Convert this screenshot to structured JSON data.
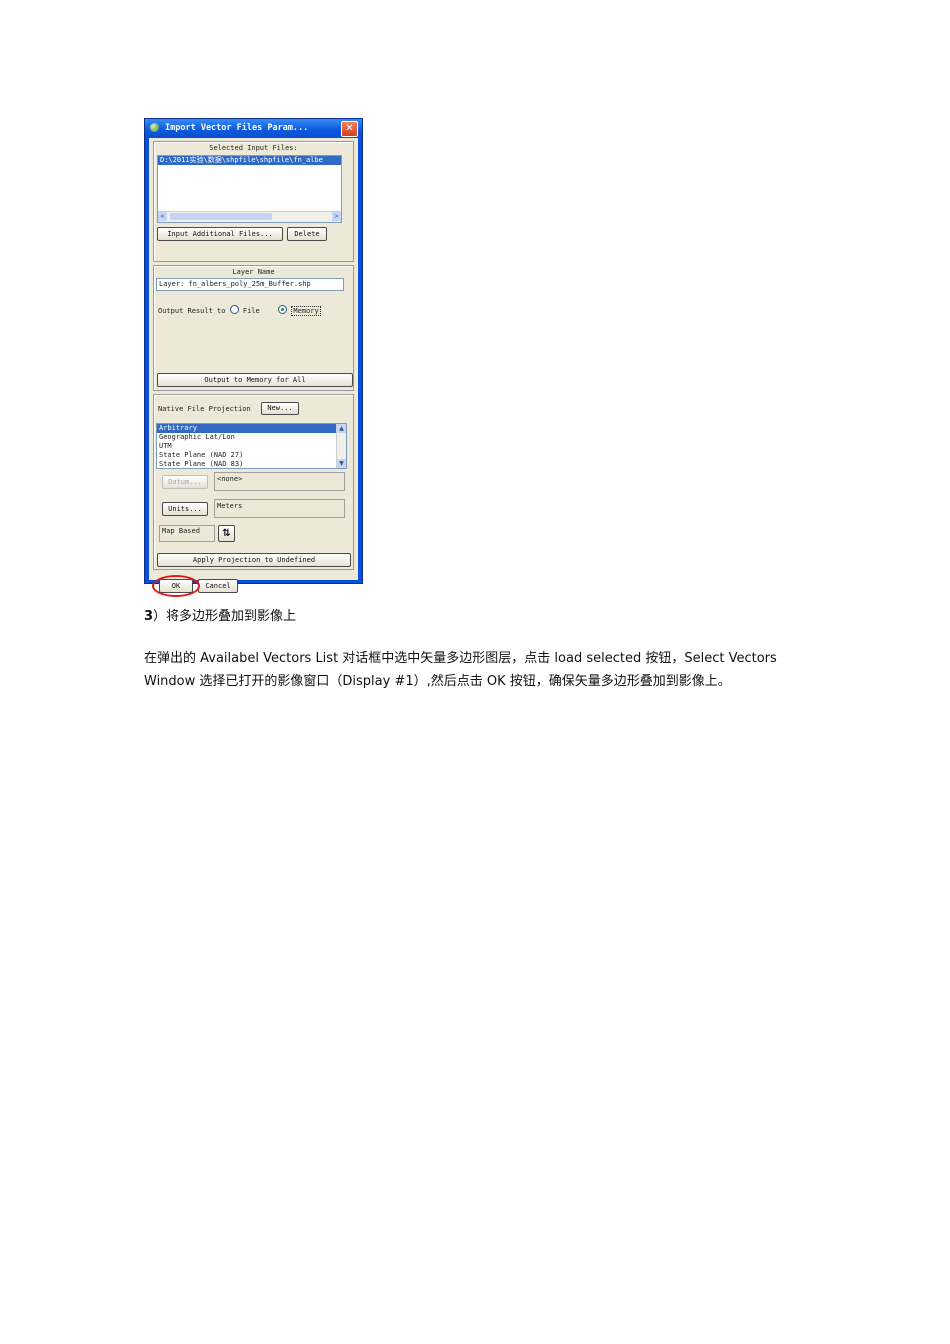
{
  "dialog": {
    "title": "Import Vector Files Param...",
    "close_glyph": "✕",
    "selected_input_files": {
      "label": "Selected Input Files:",
      "items": [
        "D:\\2011实验\\数据\\shpfile\\shpfile\\fn_albe"
      ],
      "scroll_left": "<",
      "scroll_right": ">"
    },
    "input_additional_button": "Input Additional Files...",
    "delete_button": "Delete",
    "layer_name": {
      "label": "Layer Name",
      "value": "Layer: fn_albers_poly_25m_Buffer.shp"
    },
    "output_result": {
      "label": "Output Result to",
      "option_file": "File",
      "option_memory": "Memory",
      "selected": "Memory"
    },
    "output_memory_all_button": "Output to Memory for All",
    "native_projection": {
      "label": "Native File Projection",
      "new_button": "New...",
      "items": [
        "Arbitrary",
        "Geographic Lat/Lon",
        "UTM",
        "State Plane (NAD 27)",
        "State Plane (NAD 83)"
      ],
      "selected_index": 0
    },
    "datum": {
      "button": "Datum...",
      "value": "<none>"
    },
    "units": {
      "button": "Units...",
      "value": "Meters"
    },
    "map_based": {
      "label": "Map Based",
      "arrows_glyph": "⇅"
    },
    "apply_projection_button": "Apply Projection to Undefined",
    "ok_button": "OK",
    "cancel_button": "Cancel"
  },
  "document": {
    "step_number": "3",
    "step_title": "）将多边形叠加到影像上",
    "paragraph_line1": "在弹出的 Availabel Vectors List 对话框中选中矢量多边形图层，点击 load selected 按钮，Select Vectors",
    "paragraph_line2": "Window 选择已打开的影像窗口（Display #1）,然后点击 OK 按钮，确保矢量多边形叠加到影像上。"
  },
  "colors": {
    "titlebar": "#0b5be0",
    "dialog_face": "#ece9d8",
    "selection": "#316ac5",
    "highlight_ring": "#d81c1c"
  }
}
